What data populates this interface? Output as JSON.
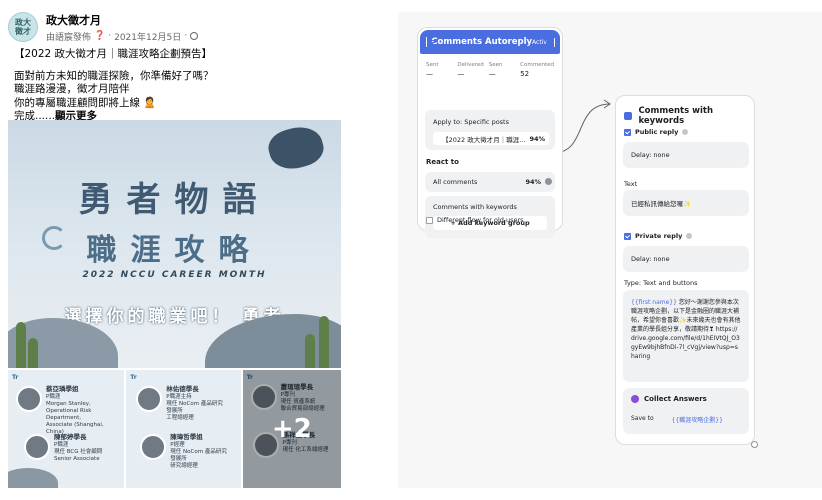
{
  "post": {
    "page_name": "政大徵才月",
    "avatar_text": "政大\n徵才",
    "posted_by": "由語宸發佈",
    "date": "2021年12月5日",
    "title_line": "【2022 政大徵才月｜職涯攻略企劃預告】",
    "lines": [
      "面對前方未知的職涯探險，你準備好了嗎？",
      "職涯路漫漫，徵才月陪伴",
      "你的專屬職涯顧問即將上線 🙎"
    ],
    "more_prefix": "完成......",
    "more_label": "顯示更多",
    "hero": {
      "title1": "勇者物語",
      "title2": "職涯攻略",
      "subtitle": "2022 NCCU CAREER MONTH",
      "cta": "選擇你的職業吧！ 勇者"
    },
    "thumbs": [
      {
        "tag": "Tr",
        "people": [
          {
            "name": "蔡亞璘學姐",
            "lines": [
              "P職涯",
              "Morgan Stanley,",
              "Operational Risk Department,",
              "Associate (Shanghai, China)"
            ]
          },
          {
            "name": "陳郁婷學長",
            "lines": [
              "P職涯",
              "現任 BCG 社會顧問",
              "Senior Associate"
            ]
          }
        ]
      },
      {
        "tag": "Tr",
        "people": [
          {
            "name": "林佑德學長",
            "lines": [
              "P職涯主持",
              "現任 NoCom 產品研究發展所",
              "工程總經理"
            ]
          },
          {
            "name": "陳瑋哲學姐",
            "lines": [
              "P經理",
              "現任 NoCom 產品研究發展所",
              "研究總經理"
            ]
          }
        ]
      },
      {
        "tag": "Tr",
        "people": [
          {
            "name": "蕭瑄瑄學長",
            "lines": [
              "P專刊",
              "現任 資產系統",
              "聯合貿易部總經理"
            ]
          },
          {
            "name": "孫祥鋐學長",
            "lines": [
              "P專刊",
              "現任 化工系總經理"
            ]
          }
        ],
        "more": "+2"
      }
    ]
  },
  "flow": {
    "trigger": {
      "title": "Comments Autoreply",
      "active_label": "Active",
      "stats": [
        {
          "label": "Sent",
          "value": "—"
        },
        {
          "label": "Delivered",
          "value": "—"
        },
        {
          "label": "Seen",
          "value": "—"
        },
        {
          "label": "Commented",
          "value": "52"
        }
      ],
      "apply_label": "Apply to: Specific posts",
      "apply_value": "【2022 政大徵才月｜職涯...",
      "apply_pct": "94%",
      "react_label": "React to",
      "react_option": "All comments",
      "react_pct": "94%",
      "kw_label": "Comments with keywords",
      "kw_button": "+ Add keyword group",
      "old_users_label": "Different flow for old users"
    },
    "keywords": {
      "title": "Comments with keywords",
      "public_reply_label": "Public reply",
      "public_delay": "Delay:  none",
      "text_label": "Text",
      "public_text": "已經私訊傳給您囉✨",
      "private_reply_label": "Private reply",
      "private_delay": "Delay:  none",
      "type_label": "Type: Text and buttons",
      "message_var": "{{first name}}",
      "message_body": " 您好～謝謝您參與本次職涯攻略企劃，以下是金融圈的職涯大補帖，希望你會喜歡✨未來幾天也會有其他產業的學長姐分享，敬請期待❣ https://drive.google.com/file/d/1hEIVtQJ_O3gyEw9bjhBfnDi-7l_cVgj/view?usp=sharing",
      "collect_title": "Collect Answers",
      "save_to_label": "Save to",
      "save_to_value": "{{職涯攻略企劃}}"
    }
  },
  "colors": {
    "accent": "#4a6ee0",
    "canvas_bg": "#f7f7f8",
    "collect_icon": "#8a4cd9"
  }
}
